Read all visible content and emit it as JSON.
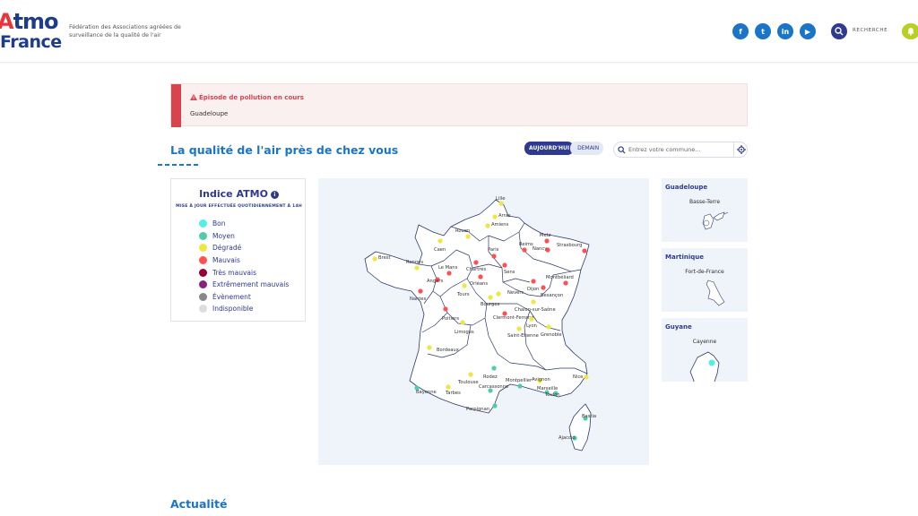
{
  "header": {
    "logo_atmo_a": "A",
    "logo_atmo_rest": "tmo",
    "logo_france": "France",
    "tagline": "Fédération des Associations agréées de surveillance de la qualité de l'air",
    "socials": [
      {
        "icon": "facebook-icon",
        "glyph": "f"
      },
      {
        "icon": "twitter-icon",
        "glyph": "t"
      },
      {
        "icon": "linkedin-icon",
        "glyph": "in"
      },
      {
        "icon": "youtube-icon",
        "glyph": "▶"
      }
    ],
    "search_label": "RECHERCHE"
  },
  "alert": {
    "title": "Épisode de pollution en cours",
    "body": "Guadeloupe"
  },
  "main": {
    "title": "La qualité de l'air près de chez vous",
    "toggle_today": "AUJOURD'HUI",
    "toggle_tomorrow": "DEMAIN",
    "commune_placeholder": "Entrez votre commune..."
  },
  "legend": {
    "title": "Indice ATMO",
    "info": "i",
    "subtitle": "MISE À JOUR EFFECTUÉE QUOTIDIENNEMENT À 14H",
    "items": [
      {
        "label": "Bon",
        "color": "#50f0e6"
      },
      {
        "label": "Moyen",
        "color": "#50ccaa"
      },
      {
        "label": "Dégradé",
        "color": "#f0e641"
      },
      {
        "label": "Mauvais",
        "color": "#ff5050"
      },
      {
        "label": "Très mauvais",
        "color": "#960032"
      },
      {
        "label": "Extrêmement mauvais",
        "color": "#872181"
      },
      {
        "label": "Évènement",
        "color": "#888888"
      },
      {
        "label": "Indisponible",
        "color": "#dddddd"
      }
    ]
  },
  "cities": [
    {
      "name": "Lille",
      "level": "Dégradé"
    },
    {
      "name": "Arras",
      "level": "Dégradé"
    },
    {
      "name": "Amiens",
      "level": "Dégradé"
    },
    {
      "name": "Rouen",
      "level": "Dégradé"
    },
    {
      "name": "Caen",
      "level": "Dégradé"
    },
    {
      "name": "Reims",
      "level": "Mauvais"
    },
    {
      "name": "Metz",
      "level": "Mauvais"
    },
    {
      "name": "Nancy",
      "level": "Mauvais"
    },
    {
      "name": "Strasbourg",
      "level": "Mauvais"
    },
    {
      "name": "Paris",
      "level": "Mauvais"
    },
    {
      "name": "Brest",
      "level": "Dégradé"
    },
    {
      "name": "Rennes",
      "level": "Dégradé"
    },
    {
      "name": "Le Mans",
      "level": "Mauvais"
    },
    {
      "name": "Chartres",
      "level": "Mauvais"
    },
    {
      "name": "Sens",
      "level": "Mauvais"
    },
    {
      "name": "Orléans",
      "level": "Mauvais"
    },
    {
      "name": "Angers",
      "level": "Mauvais"
    },
    {
      "name": "Nantes",
      "level": "Mauvais"
    },
    {
      "name": "Tours",
      "level": "Dégradé"
    },
    {
      "name": "Dijon",
      "level": "Mauvais"
    },
    {
      "name": "Montbéliard",
      "level": "Mauvais"
    },
    {
      "name": "Besançon",
      "level": "Mauvais"
    },
    {
      "name": "Nevers",
      "level": "Dégradé"
    },
    {
      "name": "Bourges",
      "level": "Dégradé"
    },
    {
      "name": "Chalon-sur-Saône",
      "level": "Dégradé"
    },
    {
      "name": "Poitiers",
      "level": "Mauvais"
    },
    {
      "name": "Clermont-Ferrand",
      "level": "Mauvais"
    },
    {
      "name": "Lyon",
      "level": "Dégradé"
    },
    {
      "name": "Limoges",
      "level": "Dégradé"
    },
    {
      "name": "Saint-Etienne",
      "level": "Dégradé"
    },
    {
      "name": "Grenoble",
      "level": "Dégradé"
    },
    {
      "name": "Bordeaux",
      "level": "Dégradé"
    },
    {
      "name": "Rodez",
      "level": "Moyen"
    },
    {
      "name": "Toulouse",
      "level": "Dégradé"
    },
    {
      "name": "Avignon",
      "level": "Dégradé"
    },
    {
      "name": "Nice",
      "level": "Dégradé"
    },
    {
      "name": "Montpellier",
      "level": "Moyen"
    },
    {
      "name": "Marseille",
      "level": "Moyen"
    },
    {
      "name": "Carcassonne",
      "level": "Moyen"
    },
    {
      "name": "Bayonne",
      "level": "Moyen"
    },
    {
      "name": "Tarbes",
      "level": "Dégradé"
    },
    {
      "name": "Toulon",
      "level": "Moyen"
    },
    {
      "name": "Perpignan",
      "level": "Moyen"
    },
    {
      "name": "Bastia",
      "level": "Moyen"
    },
    {
      "name": "Ajaccio",
      "level": "Moyen"
    }
  ],
  "overseas": [
    {
      "name": "Guadeloupe",
      "city": "Basse-Terre"
    },
    {
      "name": "Martinique",
      "city": "Fort-de-France"
    },
    {
      "name": "Guyane",
      "city": "Cayenne",
      "level": "Bon"
    }
  ],
  "news": {
    "title": "Actualité"
  }
}
